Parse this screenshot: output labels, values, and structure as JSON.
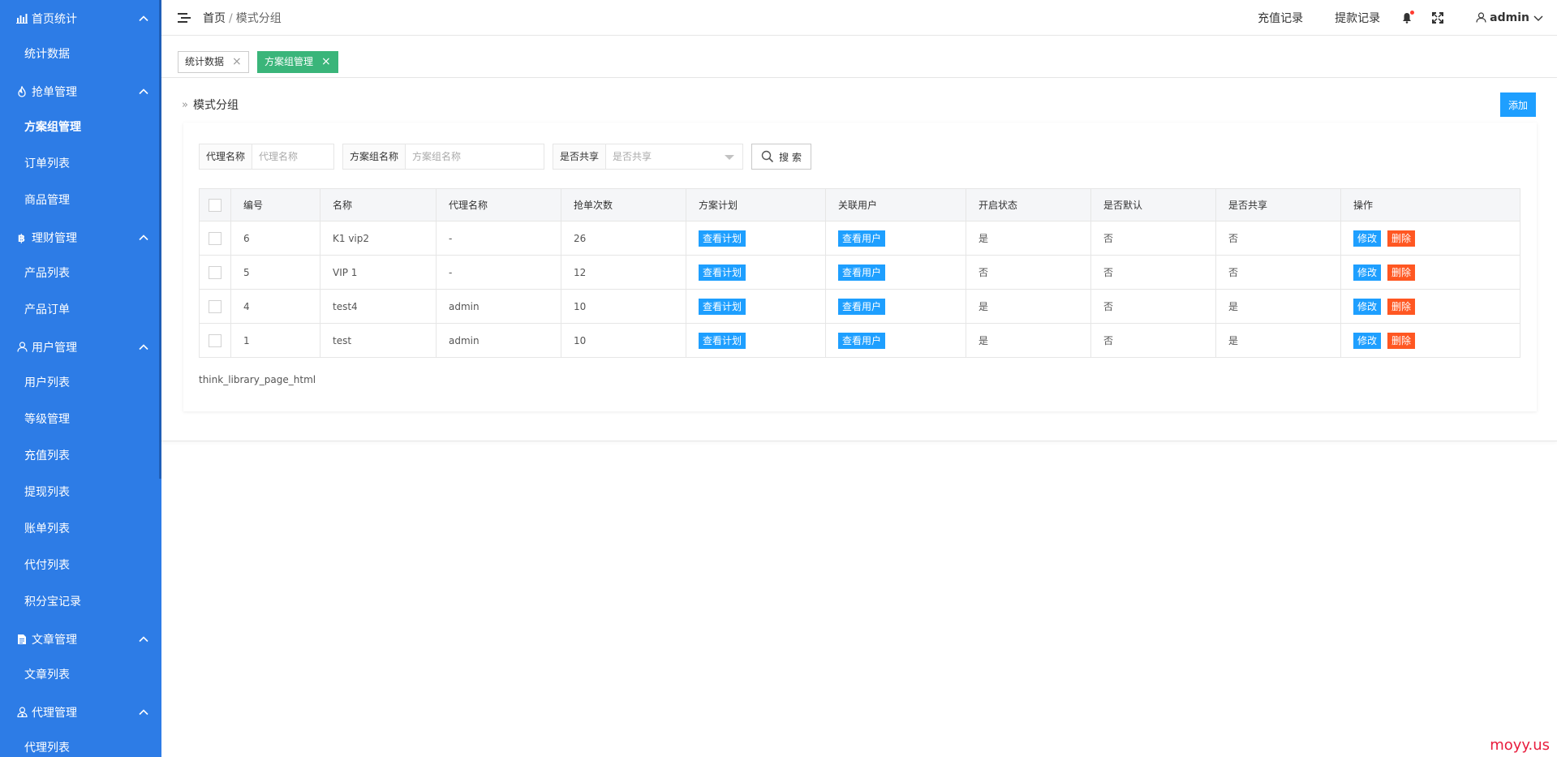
{
  "sidebar": {
    "groups": [
      {
        "label": "首页统计",
        "icon": "bar-chart-icon",
        "items": [
          "统计数据"
        ]
      },
      {
        "label": "抢单管理",
        "icon": "fire-icon",
        "items": [
          "方案组管理",
          "订单列表",
          "商品管理"
        ]
      },
      {
        "label": "理财管理",
        "icon": "bitcoin-icon",
        "items": [
          "产品列表",
          "产品订单"
        ]
      },
      {
        "label": "用户管理",
        "icon": "user-icon",
        "items": [
          "用户列表",
          "等级管理",
          "充值列表",
          "提现列表",
          "账单列表",
          "代付列表",
          "积分宝记录"
        ]
      },
      {
        "label": "文章管理",
        "icon": "document-icon",
        "items": [
          "文章列表"
        ]
      },
      {
        "label": "代理管理",
        "icon": "agent-icon",
        "items": [
          "代理列表"
        ]
      }
    ],
    "active_item": "方案组管理"
  },
  "header": {
    "breadcrumb_home": "首页",
    "breadcrumb_sep": "/",
    "breadcrumb_current": "模式分组",
    "recharge_link": "充值记录",
    "withdraw_link": "提款记录",
    "user_name": "admin"
  },
  "tabs": [
    {
      "label": "统计数据",
      "close": "×",
      "active": false
    },
    {
      "label": "方案组管理",
      "close": "×",
      "active": true
    }
  ],
  "page": {
    "title_prefix": "»",
    "title": "模式分组",
    "add_button": "添加"
  },
  "filters": {
    "agent_label": "代理名称",
    "agent_placeholder": "代理名称",
    "group_label": "方案组名称",
    "group_placeholder": "方案组名称",
    "share_label": "是否共享",
    "share_placeholder": "是否共享",
    "search_button": "搜 索"
  },
  "table": {
    "headers": [
      "编号",
      "名称",
      "代理名称",
      "抢单次数",
      "方案计划",
      "关联用户",
      "开启状态",
      "是否默认",
      "是否共享",
      "操作"
    ],
    "plan_button": "查看计划",
    "users_button": "查看用户",
    "edit_button": "修改",
    "delete_button": "删除",
    "rows": [
      {
        "id": "6",
        "name": "K1 vip2",
        "agent": "-",
        "count": "26",
        "enabled": "是",
        "default": "否",
        "shared": "否"
      },
      {
        "id": "5",
        "name": "VIP 1",
        "agent": "-",
        "count": "12",
        "enabled": "否",
        "default": "否",
        "shared": "否"
      },
      {
        "id": "4",
        "name": "test4",
        "agent": "admin",
        "count": "10",
        "enabled": "是",
        "default": "否",
        "shared": "是"
      },
      {
        "id": "1",
        "name": "test",
        "agent": "admin",
        "count": "10",
        "enabled": "是",
        "default": "否",
        "shared": "是"
      }
    ]
  },
  "pager_text": "think_library_page_html",
  "watermark": "moyy.us",
  "colors": {
    "sidebar_bg": "#2d7ce6",
    "primary": "#1e9fff",
    "danger": "#ff5722",
    "tab_active": "#3ab57a"
  }
}
